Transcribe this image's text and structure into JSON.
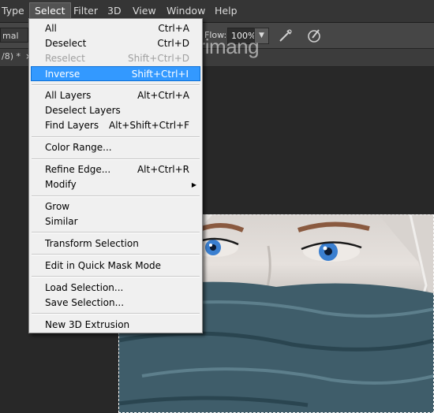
{
  "menubar": {
    "items": [
      "Type",
      "Select",
      "Filter",
      "3D",
      "View",
      "Window",
      "Help"
    ],
    "active": "Select"
  },
  "options_bar": {
    "blend_mode": "mal",
    "flow_label": "Flow:",
    "flow_value": "100%",
    "icons": [
      "flow-dropdown-arrow-icon",
      "airbrush-icon",
      "tablet-pressure-icon"
    ]
  },
  "tab": {
    "title_fragment": "/8) *",
    "close": "×"
  },
  "select_menu": {
    "items": [
      {
        "label": "All",
        "shortcut": "Ctrl+A",
        "disabled": false,
        "highlighted": false
      },
      {
        "label": "Deselect",
        "shortcut": "Ctrl+D",
        "disabled": false,
        "highlighted": false
      },
      {
        "label": "Reselect",
        "shortcut": "Shift+Ctrl+D",
        "disabled": true,
        "highlighted": false
      },
      {
        "label": "Inverse",
        "shortcut": "Shift+Ctrl+I",
        "disabled": false,
        "highlighted": true
      },
      {
        "label": "All Layers",
        "shortcut": "Alt+Ctrl+A",
        "disabled": false,
        "highlighted": false
      },
      {
        "label": "Deselect Layers",
        "shortcut": "",
        "disabled": false,
        "highlighted": false
      },
      {
        "label": "Find Layers",
        "shortcut": "Alt+Shift+Ctrl+F",
        "disabled": false,
        "highlighted": false
      },
      {
        "label": "Color Range...",
        "shortcut": "",
        "disabled": false,
        "highlighted": false
      },
      {
        "label": "Refine Edge...",
        "shortcut": "Alt+Ctrl+R",
        "disabled": false,
        "highlighted": false
      },
      {
        "label": "Modify",
        "shortcut": "",
        "disabled": false,
        "highlighted": false,
        "submenu": true
      },
      {
        "label": "Grow",
        "shortcut": "",
        "disabled": false,
        "highlighted": false
      },
      {
        "label": "Similar",
        "shortcut": "",
        "disabled": false,
        "highlighted": false
      },
      {
        "label": "Transform Selection",
        "shortcut": "",
        "disabled": false,
        "highlighted": false
      },
      {
        "label": "Edit in Quick Mask Mode",
        "shortcut": "",
        "disabled": false,
        "highlighted": false
      },
      {
        "label": "Load Selection...",
        "shortcut": "",
        "disabled": false,
        "highlighted": false
      },
      {
        "label": "Save Selection...",
        "shortcut": "",
        "disabled": false,
        "highlighted": false
      },
      {
        "label": "New 3D Extrusion",
        "shortcut": "",
        "disabled": false,
        "highlighted": false
      }
    ]
  },
  "watermark": "uantrimang",
  "colors": {
    "menu_highlight": "#3399ff",
    "menubar_bg": "#353535",
    "workspace_bg": "#282828",
    "eye_blue": "#3a7fd0"
  }
}
